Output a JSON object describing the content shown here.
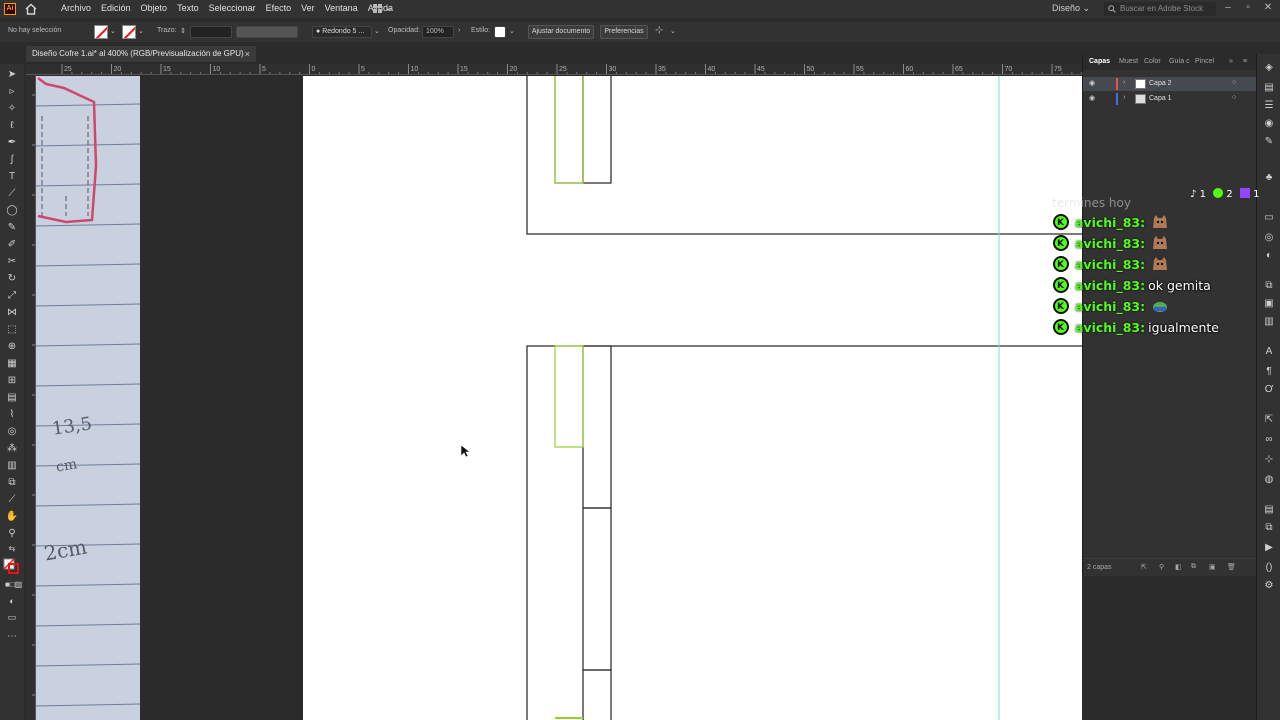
{
  "menubar": {
    "items": [
      "Archivo",
      "Edición",
      "Objeto",
      "Texto",
      "Seleccionar",
      "Efecto",
      "Ver",
      "Ventana",
      "Ayuda"
    ],
    "workspace": "Diseño",
    "search_placeholder": "Buscar en Adobe Stock"
  },
  "controlbar": {
    "selection_status": "No hay selección",
    "stroke_label": "Trazo:",
    "brush_label": "Redondo 5 ...",
    "opacity_label": "Opacidad:",
    "opacity_value": "100%",
    "style_label": "Estilo:",
    "fit_document_button": "Ajustar documento",
    "preferences_button": "Preferencias"
  },
  "document": {
    "tab_title": "Diseño Cofre 1.ai* al 400% (RGB/Previsualización de GPU)",
    "close_glyph": "×"
  },
  "ruler": {
    "top_labels": [
      "25",
      "20",
      "15",
      "10",
      "5",
      "0",
      "5",
      "10",
      "15",
      "20",
      "25",
      "30",
      "35",
      "40",
      "45",
      "50",
      "55",
      "60",
      "65",
      "70",
      "75",
      "8"
    ]
  },
  "layers_panel": {
    "tabs": [
      "Capas",
      "Muest",
      "Color",
      "Guía c",
      "Pincel"
    ],
    "layers": [
      {
        "name": "Capa 2",
        "selected": true,
        "color": "#e25555"
      },
      {
        "name": "Capa 1",
        "selected": false,
        "color": "#4a6ce0"
      }
    ],
    "footer_count": "2 capas"
  },
  "paper_notes": {
    "measure_1": "13,5",
    "measure_1_unit": "cm",
    "measure_2": "2cm"
  },
  "chat": {
    "faded_text": "termines hoy",
    "platform_counts": {
      "tiktok": "1",
      "kick": "2",
      "twitch": "1"
    },
    "messages": [
      {
        "user": "avichi_83:",
        "text": "",
        "emote": "cat"
      },
      {
        "user": "avichi_83:",
        "text": "",
        "emote": "cat"
      },
      {
        "user": "avichi_83:",
        "text": "",
        "emote": "cat"
      },
      {
        "user": "avichi_83:",
        "text": "ok gemita",
        "emote": ""
      },
      {
        "user": "avichi_83:",
        "text": "",
        "emote": "frog"
      },
      {
        "user": "avichi_83:",
        "text": "igualmente",
        "emote": ""
      }
    ]
  },
  "colors": {
    "accent_selection": "#9acd32",
    "guide": "#7fd8e6",
    "kick_green": "#53fc18"
  }
}
